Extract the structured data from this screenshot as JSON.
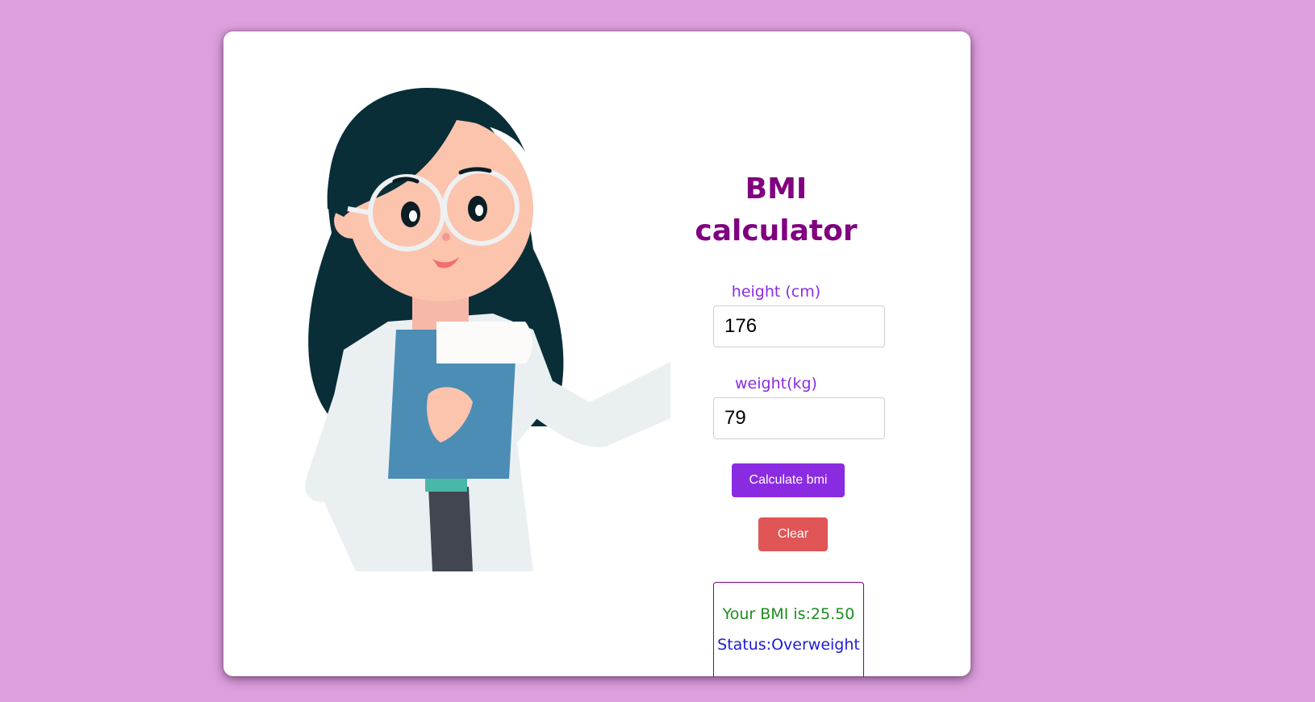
{
  "title": "BMI calculator",
  "title_line1": "BMI",
  "title_line2": "calculator",
  "height": {
    "label": "height (cm)",
    "value": "176"
  },
  "weight": {
    "label": "weight(kg)",
    "value": "79"
  },
  "buttons": {
    "calculate": "Calculate bmi",
    "clear": "Clear"
  },
  "result": {
    "bmi": "Your BMI is:25.50",
    "status": "Status:Overweight"
  },
  "colors": {
    "background": "#dda0dd",
    "title": "#800080",
    "label": "#8a2be2",
    "calculate_button": "#8a2be2",
    "clear_button": "#e05555",
    "bmi_text": "#1e8c1e",
    "status_text": "#1c1cd6"
  },
  "illustration": "doctor-woman-with-clipboard-icon"
}
